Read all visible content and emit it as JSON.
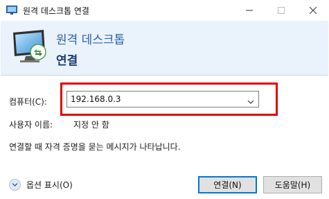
{
  "window": {
    "title": "원격 데스크톱 연결"
  },
  "banner": {
    "title": "원격 데스크톱",
    "subtitle": "연결"
  },
  "form": {
    "computer_label": "컴퓨터(C):",
    "computer_value": "192.168.0.3",
    "username_label": "사용자 이름:",
    "username_value": "지정 안 함",
    "info_text": "연결할 때 자격 증명을 묻는 메시지가 나타납니다."
  },
  "footer": {
    "options_label": "옵션 표시(O)",
    "connect_button": "연결(N)",
    "help_button": "도움말(H)"
  },
  "colors": {
    "banner_bg": "#eaf2fb",
    "banner_title": "#2a63aa",
    "highlight": "#e00000",
    "focus_border": "#0078d7"
  }
}
